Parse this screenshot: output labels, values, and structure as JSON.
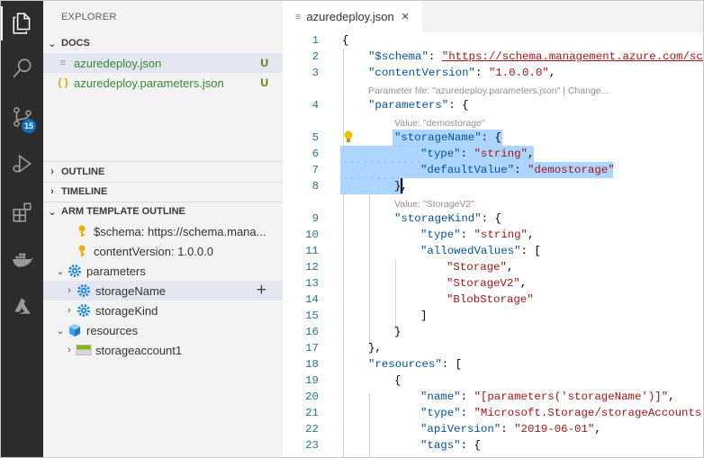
{
  "sidebar": {
    "title": "EXPLORER",
    "docs_section": "DOCS",
    "files": [
      {
        "name": "azuredeploy.json",
        "status": "U",
        "icon": "json-file-icon"
      },
      {
        "name": "azuredeploy.parameters.json",
        "status": "U",
        "icon": "json-braces-icon"
      }
    ],
    "outline_section": "OUTLINE",
    "timeline_section": "TIMELINE",
    "arm_section": "ARM TEMPLATE OUTLINE",
    "arm_items": [
      {
        "label": "$schema: https://schema.mana...",
        "icon": "key-icon"
      },
      {
        "label": "contentVersion: 1.0.0.0",
        "icon": "key-icon"
      },
      {
        "label": "parameters",
        "icon": "gear-icon"
      },
      {
        "label": "storageName",
        "icon": "gear-icon"
      },
      {
        "label": "storageKind",
        "icon": "gear-icon"
      },
      {
        "label": "resources",
        "icon": "cube-icon"
      },
      {
        "label": "storageaccount1",
        "icon": "storage-icon"
      }
    ]
  },
  "activity": {
    "scm_badge": "15"
  },
  "editor": {
    "tab_title": "azuredeploy.json",
    "lenses": {
      "param_file": "Parameter file: \"azuredeploy.parameters.json\" | Change...",
      "value_storage": "Value: \"demostorage\"",
      "value_kind": "Value: \"StorageV2\""
    },
    "line_numbers": [
      "1",
      "2",
      "3",
      "4",
      "5",
      "6",
      "7",
      "8",
      "9",
      "10",
      "11",
      "12",
      "13",
      "14",
      "15",
      "16",
      "17",
      "18",
      "19",
      "20",
      "21",
      "22",
      "23"
    ],
    "tokens": {
      "open_brace": "{",
      "schema_key": "\"$schema\"",
      "schema_val": "\"https://schema.management.azure.com/sche",
      "cv_key": "\"contentVersion\"",
      "cv_val": "\"1.0.0.0\"",
      "params_key": "\"parameters\"",
      "storage_name_key": "\"storageName\"",
      "type_key": "\"type\"",
      "string_val": "\"string\"",
      "default_key": "\"defaultValue\"",
      "default_val": "\"demostorage\"",
      "close_brace_comma": "},",
      "storage_kind_key": "\"storageKind\"",
      "allowed_key": "\"allowedValues\"",
      "v_storage": "\"Storage\"",
      "v_storagev2": "\"StorageV2\"",
      "v_blob": "\"BlobStorage\"",
      "close_bracket": "]",
      "close_brace": "}",
      "resources_key": "\"resources\"",
      "name_key": "\"name\"",
      "name_val": "\"[parameters('storageName')]\"",
      "res_type_val": "\"Microsoft.Storage/storageAccounts\"",
      "api_key": "\"apiVersion\"",
      "api_val": "\"2019-06-01\"",
      "tags_key": "\"tags\""
    }
  },
  "colors": {
    "activity_bg": "#2c2c2c",
    "sidebar_bg": "#f3f3f3",
    "selection": "#add6ff",
    "key_color": "#0451a5",
    "string_color": "#a31515",
    "badge": "#0e70c0"
  }
}
